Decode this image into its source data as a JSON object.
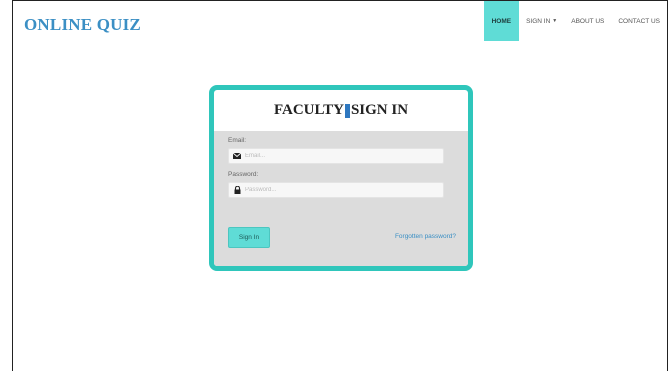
{
  "app": {
    "brand": "ONLINE QUIZ"
  },
  "nav": {
    "items": [
      {
        "label": "HOME",
        "active": true
      },
      {
        "label": "SIGN IN",
        "dropdown": true
      },
      {
        "label": "ABOUT US"
      },
      {
        "label": "CONTACT US"
      }
    ]
  },
  "login": {
    "title_left": "FACULTY",
    "title_right": "SIGN IN",
    "email_label": "Email:",
    "email_placeholder": "Email...",
    "email_value": "",
    "password_label": "Password:",
    "password_placeholder": "Password...",
    "password_value": "",
    "signin_button": "Sign In",
    "forgot_link": "Forgotten password?"
  },
  "icons": {
    "email": "envelope-icon",
    "password": "lock-icon",
    "dropdown": "caret-down-icon"
  },
  "colors": {
    "brand": "#3b8fc4",
    "accent": "#5fdcd6",
    "card_border": "#2fc6bb",
    "card_body": "#dcdcdc"
  }
}
